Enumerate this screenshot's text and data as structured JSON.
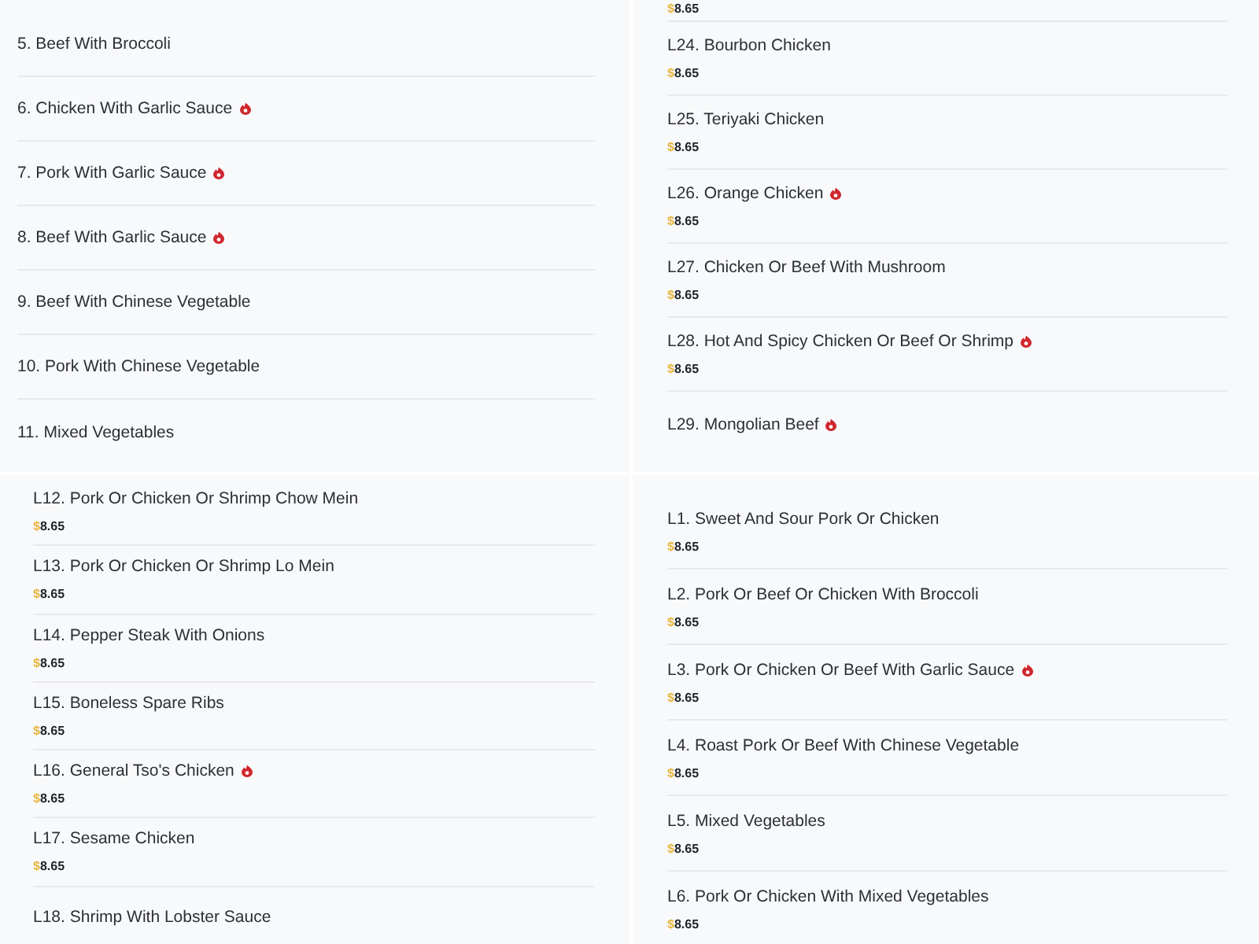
{
  "panels": [
    {
      "items": [
        {
          "name": "5. Beef With Broccoli",
          "spicy": false
        },
        {
          "name": "6. Chicken With Garlic Sauce",
          "spicy": true
        },
        {
          "name": "7. Pork With Garlic Sauce",
          "spicy": true
        },
        {
          "name": "8. Beef With Garlic Sauce",
          "spicy": true
        },
        {
          "name": "9. Beef With Chinese Vegetable",
          "spicy": false
        },
        {
          "name": "10. Pork With Chinese Vegetable",
          "spicy": false
        },
        {
          "name": "11. Mixed Vegetables",
          "spicy": false
        }
      ]
    },
    {
      "lead_price": {
        "currency": "$",
        "amount": "8.65"
      },
      "items": [
        {
          "name": "L24. Bourbon Chicken",
          "spicy": false,
          "currency": "$",
          "amount": "8.65"
        },
        {
          "name": "L25. Teriyaki Chicken",
          "spicy": false,
          "currency": "$",
          "amount": "8.65"
        },
        {
          "name": "L26. Orange Chicken",
          "spicy": true,
          "currency": "$",
          "amount": "8.65"
        },
        {
          "name": "L27. Chicken Or Beef With Mushroom",
          "spicy": false,
          "currency": "$",
          "amount": "8.65"
        },
        {
          "name": "L28. Hot And Spicy Chicken Or Beef Or Shrimp",
          "spicy": true,
          "currency": "$",
          "amount": "8.65"
        },
        {
          "name": "L29. Mongolian Beef",
          "spicy": true
        }
      ]
    },
    {
      "items": [
        {
          "name": "L12. Pork Or Chicken Or Shrimp Chow Mein",
          "spicy": false,
          "currency": "$",
          "amount": "8.65"
        },
        {
          "name": "L13. Pork Or Chicken Or Shrimp Lo Mein",
          "spicy": false,
          "currency": "$",
          "amount": "8.65"
        },
        {
          "name": "L14. Pepper Steak With Onions",
          "spicy": false,
          "currency": "$",
          "amount": "8.65"
        },
        {
          "name": "L15. Boneless Spare Ribs",
          "spicy": false,
          "currency": "$",
          "amount": "8.65"
        },
        {
          "name": "L16. General Tso's Chicken",
          "spicy": true,
          "currency": "$",
          "amount": "8.65"
        },
        {
          "name": "L17. Sesame Chicken",
          "spicy": false,
          "currency": "$",
          "amount": "8.65"
        },
        {
          "name": "L18. Shrimp With Lobster Sauce",
          "spicy": false
        }
      ]
    },
    {
      "items": [
        {
          "name": "L1. Sweet And Sour Pork Or Chicken",
          "spicy": false,
          "currency": "$",
          "amount": "8.65"
        },
        {
          "name": "L2. Pork Or Beef Or Chicken With Broccoli",
          "spicy": false,
          "currency": "$",
          "amount": "8.65"
        },
        {
          "name": "L3. Pork Or Chicken Or Beef With Garlic Sauce",
          "spicy": true,
          "currency": "$",
          "amount": "8.65"
        },
        {
          "name": "L4. Roast Pork Or Beef With Chinese Vegetable",
          "spicy": false,
          "currency": "$",
          "amount": "8.65"
        },
        {
          "name": "L5. Mixed Vegetables",
          "spicy": false,
          "currency": "$",
          "amount": "8.65"
        },
        {
          "name": "L6. Pork Or Chicken With Mixed Vegetables",
          "spicy": false,
          "currency": "$",
          "amount": "8.65"
        }
      ]
    }
  ]
}
